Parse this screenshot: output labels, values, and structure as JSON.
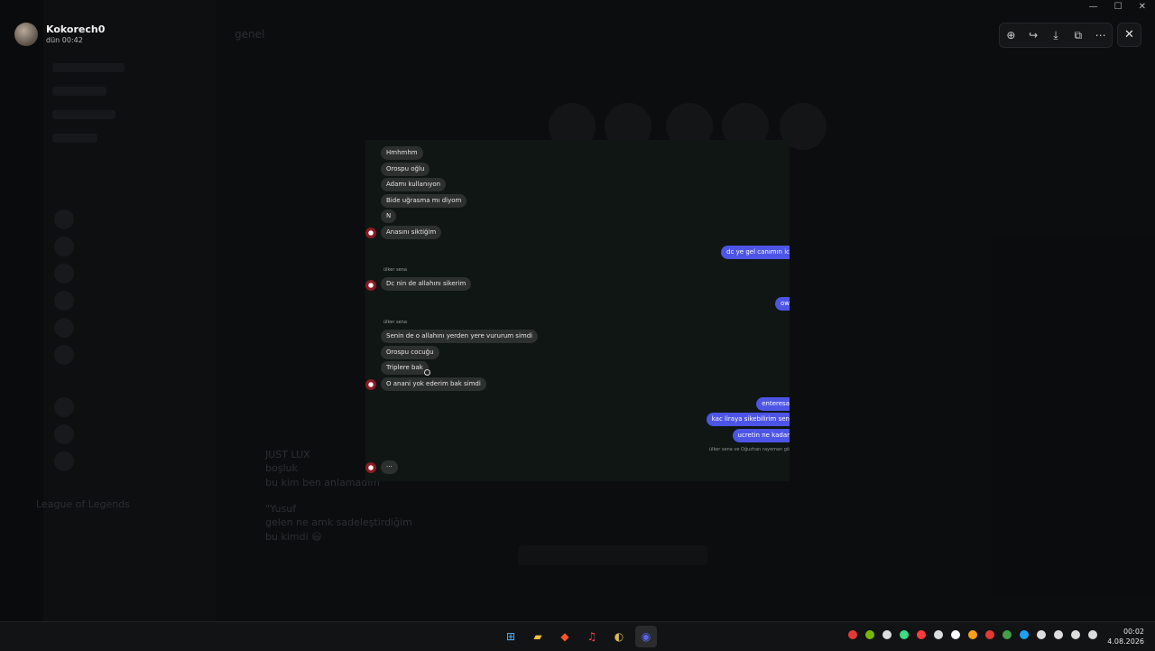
{
  "viewer": {
    "username": "Kokorech0",
    "timestamp": "dün 00:42",
    "tools": [
      {
        "icon": "zoom-in-icon",
        "glyph": "⊕"
      },
      {
        "icon": "forward-icon",
        "glyph": "↪"
      },
      {
        "icon": "download-icon",
        "glyph": "⤓"
      },
      {
        "icon": "open-external-icon",
        "glyph": "⧉"
      },
      {
        "icon": "more-icon",
        "glyph": "⋯"
      }
    ],
    "close_glyph": "✕"
  },
  "window_controls": {
    "minimize": "—",
    "maximize": "☐",
    "close": "✕"
  },
  "screenshot": {
    "messages": [
      {
        "side": "left",
        "text": "Hmhmhm"
      },
      {
        "side": "left",
        "text": "Orospu oğlu"
      },
      {
        "side": "left",
        "text": "Adamı kullanıyon"
      },
      {
        "side": "left",
        "text": "Bide uğrasma mı diyom"
      },
      {
        "side": "left",
        "text": "N"
      },
      {
        "side": "left",
        "text": "Anasını siktiğim"
      },
      {
        "side": "right",
        "text": "dc ye gel canımın ic"
      },
      {
        "side": "left",
        "text": "Dc nin de allahını sikerim"
      },
      {
        "side": "right",
        "text": "ow"
      },
      {
        "side": "left",
        "text": "Senin de o allahını yerden yere vururum simdi"
      },
      {
        "side": "left",
        "text": "Orospu cocuğu"
      },
      {
        "side": "left",
        "text": "Triplere bak"
      },
      {
        "side": "left",
        "text": "O anani yok ederim bak simdi"
      },
      {
        "side": "right",
        "text": "enteresa"
      },
      {
        "side": "right",
        "text": "kac liraya sikebilirim sen"
      },
      {
        "side": "right",
        "text": "ucretin ne kadar"
      },
      {
        "side": "left",
        "text": "···"
      }
    ],
    "sender_label": "ülker sena",
    "seen_text": "ülker sena ve Oğuzhan rayeman gö"
  },
  "background": {
    "channel": "genel",
    "messages": [
      "JUST LUX",
      "boşluk",
      "bu kim ben anlamadım",
      "\"Yusuf",
      "gelen ne amk sadeleştirdiğim",
      "bu kimdi 😃",
      "League of Legends"
    ]
  },
  "taskbar": {
    "apps": [
      {
        "name": "windows-start-icon",
        "glyph": "⊞",
        "color": "#4fb4ff"
      },
      {
        "name": "file-explorer-icon",
        "glyph": "▰",
        "color": "#f3c23c"
      },
      {
        "name": "brave-icon",
        "glyph": "◆",
        "color": "#fb542b"
      },
      {
        "name": "music-icon",
        "glyph": "♫",
        "color": "#fc3c54"
      },
      {
        "name": "app-icon",
        "glyph": "◐",
        "color": "#d9b85a"
      },
      {
        "name": "discord-icon",
        "glyph": "◉",
        "color": "#5865f2"
      }
    ],
    "tray": [
      "#e53935",
      "#76b900",
      "#dddddd",
      "#3ddc84",
      "#ff3b3b",
      "#dddddd",
      "#ffffff",
      "#ff9f1a",
      "#e53935",
      "#43a047",
      "#1da1f2",
      "#dddddd",
      "#dddddd",
      "#dddddd",
      "#dddddd"
    ],
    "time": "00:02",
    "date": "4.08.2026"
  }
}
